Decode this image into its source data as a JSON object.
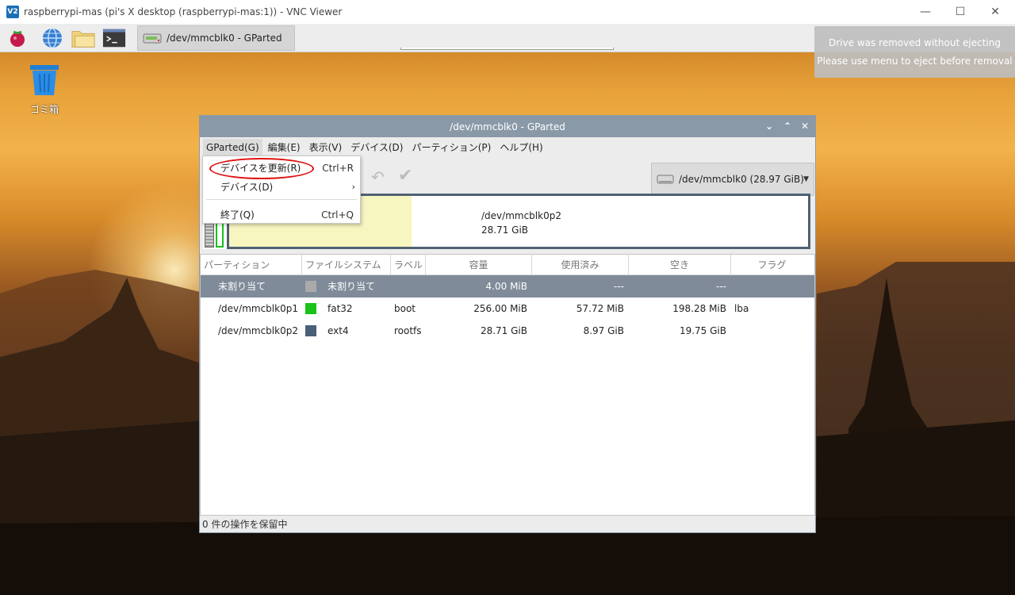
{
  "vnc": {
    "title": "raspberrypi-mas (pi's X desktop (raspberrypi-mas:1)) - VNC Viewer",
    "logo_text": "V2",
    "minimize": "—",
    "maximize": "☐",
    "close": "✕"
  },
  "taskbar": {
    "window_button_label": "/dev/mmcblk0 - GParted"
  },
  "desktop": {
    "trash_label": "ゴミ箱"
  },
  "notification": {
    "line1": "Drive was removed without ejecting",
    "line2": "Please use menu to eject before removal"
  },
  "gparted": {
    "title": "/dev/mmcblk0 - GParted",
    "controls": {
      "collapse": "⌄",
      "expand": "⌃",
      "close": "✕"
    },
    "menubar": [
      "GParted(G)",
      "編集(E)",
      "表示(V)",
      "デバイス(D)",
      "パーティション(P)",
      "ヘルプ(H)"
    ],
    "device_selector": "/dev/mmcblk0   (28.97 GiB)",
    "disk_graphic": {
      "partition_name": "/dev/mmcblk0p2",
      "partition_size": "28.71 GiB"
    },
    "table": {
      "headers": [
        "パーティション",
        "ファイルシステム",
        "ラベル",
        "容量",
        "使用済み",
        "空き",
        "フラグ"
      ],
      "rows": [
        {
          "partition": "未割り当て",
          "filesystem": "未割り当て",
          "label": "",
          "size": "4.00 MiB",
          "used": "---",
          "free": "---",
          "flags": "",
          "swatch": "#aaaaaa"
        },
        {
          "partition": "/dev/mmcblk0p1",
          "filesystem": "fat32",
          "label": "boot",
          "size": "256.00 MiB",
          "used": "57.72 MiB",
          "free": "198.28 MiB",
          "flags": "lba",
          "swatch": "#18c418"
        },
        {
          "partition": "/dev/mmcblk0p2",
          "filesystem": "ext4",
          "label": "rootfs",
          "size": "28.71 GiB",
          "used": "8.97 GiB",
          "free": "19.75 GiB",
          "flags": "",
          "swatch": "#4a5f78"
        }
      ]
    },
    "status": "0 件の操作を保留中",
    "dropdown": {
      "refresh_label": "デバイスを更新(R)",
      "refresh_shortcut": "Ctrl+R",
      "devices_label": "デバイス(D)",
      "devices_arrow": "›",
      "quit_label": "終了(Q)",
      "quit_shortcut": "Ctrl+Q"
    }
  },
  "colors": {
    "titlebar": "#8a99a8",
    "selected_row": "#7f8b99",
    "highlight": "#e01010"
  }
}
